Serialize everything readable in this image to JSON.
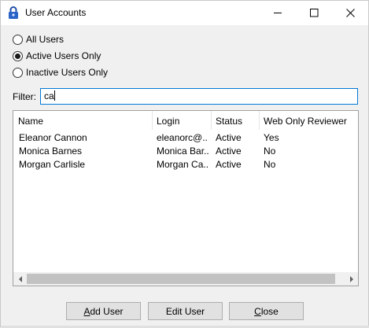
{
  "window": {
    "title": "User Accounts",
    "icons": {
      "app": "lock-icon",
      "minimize": "minimize-icon",
      "maximize": "maximize-icon",
      "close": "close-icon"
    }
  },
  "radio_options": [
    {
      "label": "All Users",
      "checked": false
    },
    {
      "label": "Active Users Only",
      "checked": true
    },
    {
      "label": "Inactive Users Only",
      "checked": false
    }
  ],
  "filter": {
    "label": "Filter:",
    "value": "ca"
  },
  "list": {
    "columns": [
      "Name",
      "Login",
      "Status",
      "Web Only Reviewer"
    ],
    "rows": [
      {
        "name": "Eleanor Cannon",
        "login": "eleanorc@...",
        "status": "Active",
        "web_only_reviewer": "Yes"
      },
      {
        "name": "Monica Barnes",
        "login": "Monica Bar...",
        "status": "Active",
        "web_only_reviewer": "No"
      },
      {
        "name": "Morgan Carlisle",
        "login": "Morgan Ca...",
        "status": "Active",
        "web_only_reviewer": "No"
      }
    ],
    "scrollbar_icons": {
      "left": "scroll-left-arrow-icon",
      "right": "scroll-right-arrow-icon"
    }
  },
  "buttons": {
    "add_user": {
      "mnemonic": "A",
      "rest": "dd User"
    },
    "edit_user": "Edit User",
    "close": {
      "mnemonic": "C",
      "rest": "lose"
    }
  },
  "colors": {
    "focus_border": "#0078d7",
    "button_bg": "#e1e1e1",
    "window_bg": "#f0f0f0"
  }
}
